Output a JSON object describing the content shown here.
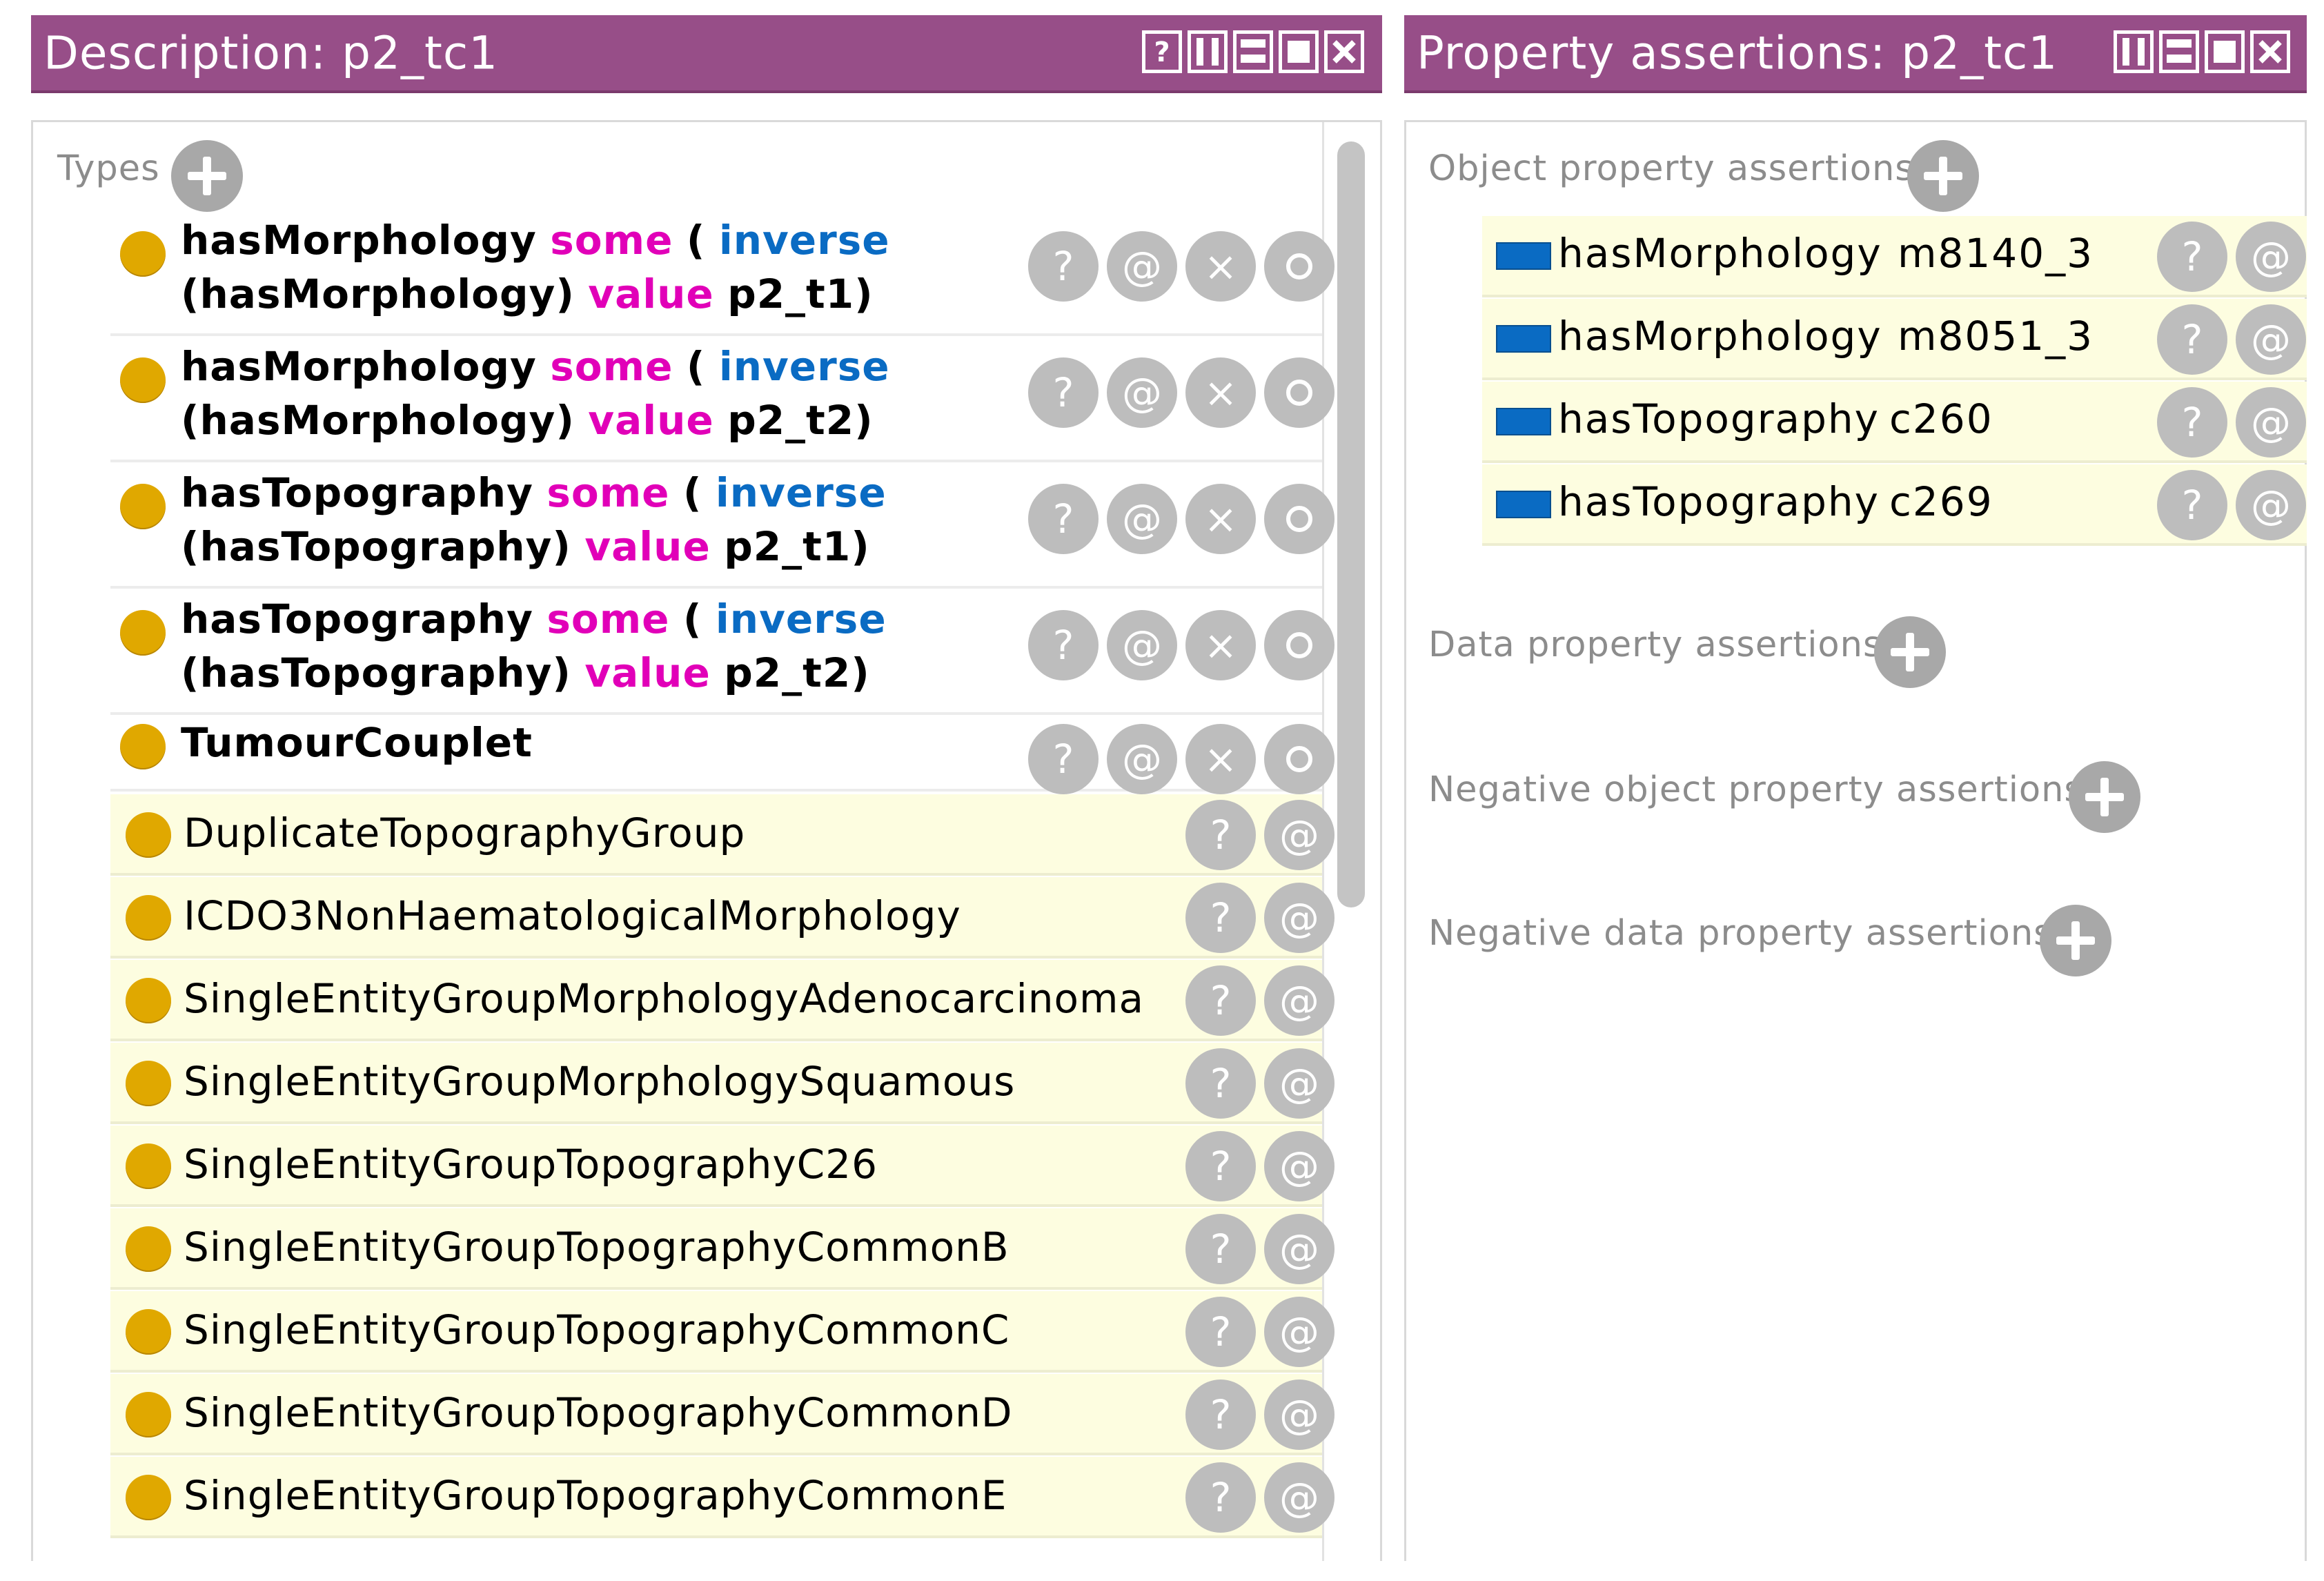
{
  "left_panel": {
    "title": "Description: p2_tc1",
    "types_label": "Types",
    "expressions": [
      {
        "prop": "hasMorphology",
        "some": "some",
        "paren": "(",
        "inverse": "inverse",
        "inner": "(hasMorphology)",
        "value_kw": "value",
        "individual": "p2_t1)"
      },
      {
        "prop": "hasMorphology",
        "some": "some",
        "paren": "(",
        "inverse": "inverse",
        "inner": "(hasMorphology)",
        "value_kw": "value",
        "individual": "p2_t2)"
      },
      {
        "prop": "hasTopography",
        "some": "some",
        "paren": "(",
        "inverse": "inverse",
        "inner": "(hasTopography)",
        "value_kw": "value",
        "individual": "p2_t1)"
      },
      {
        "prop": "hasTopography",
        "some": "some",
        "paren": "(",
        "inverse": "inverse",
        "inner": "(hasTopography)",
        "value_kw": "value",
        "individual": "p2_t2)"
      }
    ],
    "asserted_class": "TumourCouplet",
    "inferred_classes": [
      "DuplicateTopographyGroup",
      "ICDO3NonHaematologicalMorphology",
      "SingleEntityGroupMorphologyAdenocarcinoma",
      "SingleEntityGroupMorphologySquamous",
      "SingleEntityGroupTopographyC26",
      "SingleEntityGroupTopographyCommonB",
      "SingleEntityGroupTopographyCommonC",
      "SingleEntityGroupTopographyCommonD",
      "SingleEntityGroupTopographyCommonE"
    ]
  },
  "right_panel": {
    "title": "Property assertions: p2_tc1",
    "object_label": "Object property assertions",
    "object_assertions": [
      {
        "property": "hasMorphology",
        "value": "m8140_3"
      },
      {
        "property": "hasMorphology",
        "value": "m8051_3"
      },
      {
        "property": "hasTopography",
        "value": "c260"
      },
      {
        "property": "hasTopography",
        "value": "c269"
      }
    ],
    "data_label": "Data property assertions",
    "neg_object_label": "Negative object property assertions",
    "neg_data_label": "Negative data property assertions"
  },
  "row_buttons": {
    "explain": "?",
    "annotate": "@",
    "delete": "×"
  },
  "colors": {
    "title_bar": "#974e88",
    "class_dot": "#e0a800",
    "keyword_some_value": "#e100b8",
    "keyword_inverse": "#0a6bc3",
    "object_property": "#0a6bc3",
    "inferred_row_bg": "#fdfde0",
    "button_gray": "#bdbdbd"
  },
  "icons": {
    "window_buttons_left": [
      "help-icon",
      "split-icon",
      "minimize-icon",
      "maximize-icon",
      "close-icon"
    ],
    "window_buttons_right": [
      "split-icon",
      "minimize-icon",
      "maximize-icon",
      "close-icon"
    ],
    "class_marker": "class-circle-icon",
    "property_marker": "object-property-icon",
    "add": "plus-icon"
  }
}
